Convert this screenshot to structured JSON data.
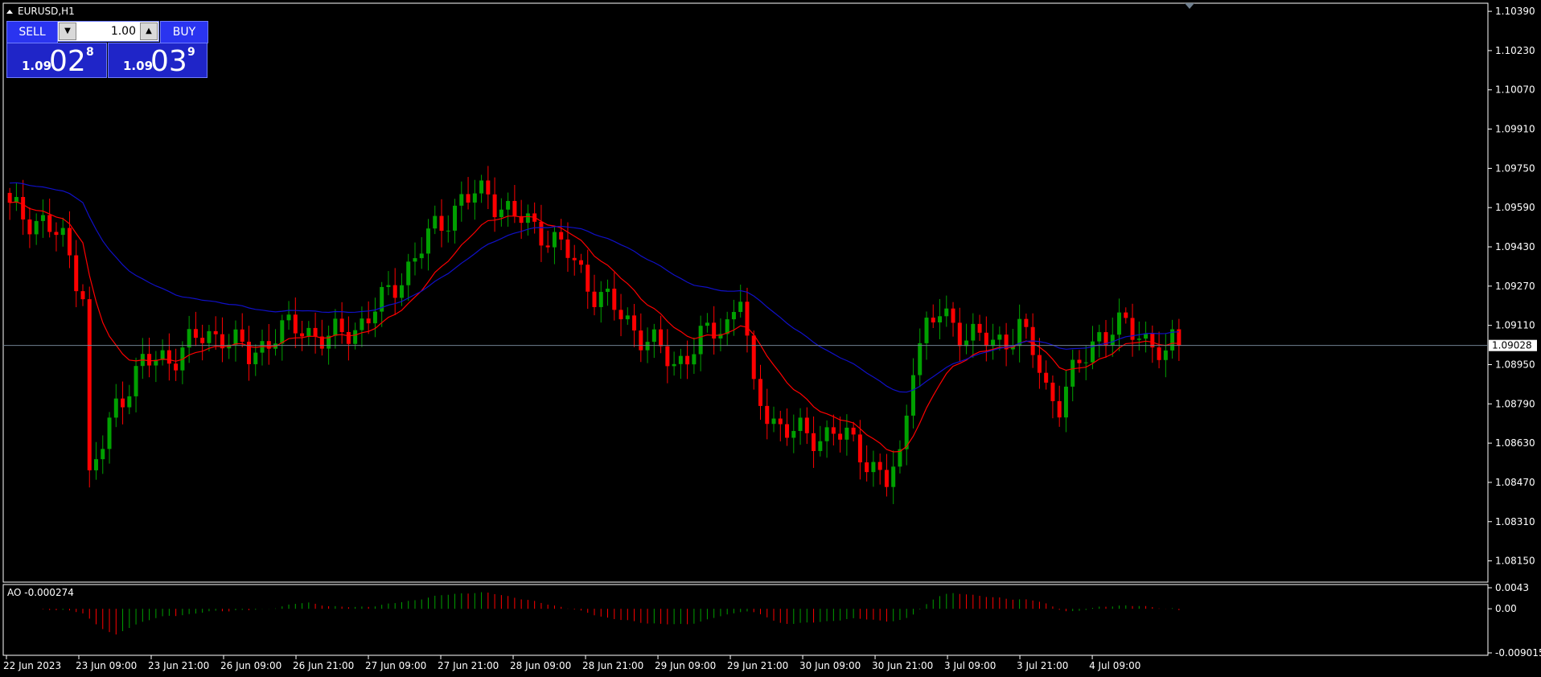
{
  "symbol_label": "EURUSD,H1",
  "trade_panel": {
    "sell_label": "SELL",
    "buy_label": "BUY",
    "lot_value": "1.00",
    "bid": {
      "small": "1.09",
      "big": "02",
      "sup": "8"
    },
    "ask": {
      "small": "1.09",
      "big": "03",
      "sup": "9"
    }
  },
  "current_price_label": "1.09028",
  "ao_label": "AO -0.000274",
  "colors": {
    "bull": "#00a000",
    "bear": "#ff0000",
    "ma_fast": "#ff0000",
    "ma_slow": "#1010c8",
    "grid_border": "#ffffff",
    "price_line": "#708090"
  },
  "chart_data": {
    "type": "candlestick",
    "symbol": "EURUSD",
    "timeframe": "H1",
    "y_ticks": [
      "1.10390",
      "1.10230",
      "1.10070",
      "1.09910",
      "1.09750",
      "1.09590",
      "1.09430",
      "1.09270",
      "1.09110",
      "1.08950",
      "1.08790",
      "1.08630",
      "1.08470",
      "1.08310",
      "1.08150"
    ],
    "ylim": [
      1.0807,
      1.1041
    ],
    "x_ticks": [
      "22 Jun 2023",
      "23 Jun 09:00",
      "23 Jun 21:00",
      "26 Jun 09:00",
      "26 Jun 21:00",
      "27 Jun 09:00",
      "27 Jun 21:00",
      "28 Jun 09:00",
      "28 Jun 21:00",
      "29 Jun 09:00",
      "29 Jun 21:00",
      "30 Jun 09:00",
      "30 Jun 21:00",
      "3 Jul 09:00",
      "3 Jul 21:00",
      "4 Jul 09:00"
    ],
    "close_anchors": [
      [
        0,
        1.0958
      ],
      [
        5,
        1.0953
      ],
      [
        8,
        1.0945
      ],
      [
        10,
        1.0932
      ],
      [
        11,
        1.0925
      ],
      [
        12,
        1.0848
      ],
      [
        14,
        1.0862
      ],
      [
        16,
        1.0878
      ],
      [
        18,
        1.0888
      ],
      [
        20,
        1.0895
      ],
      [
        24,
        1.0898
      ],
      [
        28,
        1.0905
      ],
      [
        32,
        1.0908
      ],
      [
        36,
        1.0898
      ],
      [
        40,
        1.0908
      ],
      [
        44,
        1.091
      ],
      [
        48,
        1.0905
      ],
      [
        52,
        1.091
      ],
      [
        56,
        1.092
      ],
      [
        60,
        1.0935
      ],
      [
        64,
        1.095
      ],
      [
        68,
        1.0962
      ],
      [
        72,
        1.0965
      ],
      [
        76,
        1.0955
      ],
      [
        80,
        1.095
      ],
      [
        84,
        1.094
      ],
      [
        88,
        1.0925
      ],
      [
        92,
        1.0915
      ],
      [
        96,
        1.0905
      ],
      [
        100,
        1.0895
      ],
      [
        104,
        1.0905
      ],
      [
        108,
        1.0912
      ],
      [
        110,
        1.0925
      ],
      [
        112,
        1.0882
      ],
      [
        116,
        1.087
      ],
      [
        120,
        1.0865
      ],
      [
        124,
        1.0868
      ],
      [
        128,
        1.086
      ],
      [
        132,
        1.0847
      ],
      [
        134,
        1.0855
      ],
      [
        136,
        1.0898
      ],
      [
        138,
        1.091
      ],
      [
        140,
        1.0915
      ],
      [
        144,
        1.0908
      ],
      [
        148,
        1.0903
      ],
      [
        152,
        1.091
      ],
      [
        154,
        1.09
      ],
      [
        156,
        1.0885
      ],
      [
        158,
        1.088
      ],
      [
        160,
        1.089
      ],
      [
        164,
        1.0908
      ],
      [
        168,
        1.091
      ],
      [
        172,
        1.0905
      ],
      [
        174,
        1.0896
      ],
      [
        176,
        1.091
      ]
    ],
    "candle_count": 177,
    "price_last": 1.09028,
    "ma_fast": {
      "period": 13,
      "color": "red"
    },
    "ma_slow": {
      "period": 34,
      "color": "blue"
    },
    "ao": {
      "name": "AO",
      "last_value": -0.000274,
      "y_ticks": [
        "0.0043",
        "0.00",
        "-0.009015"
      ],
      "ylim": [
        -0.009015,
        0.0043
      ]
    }
  }
}
